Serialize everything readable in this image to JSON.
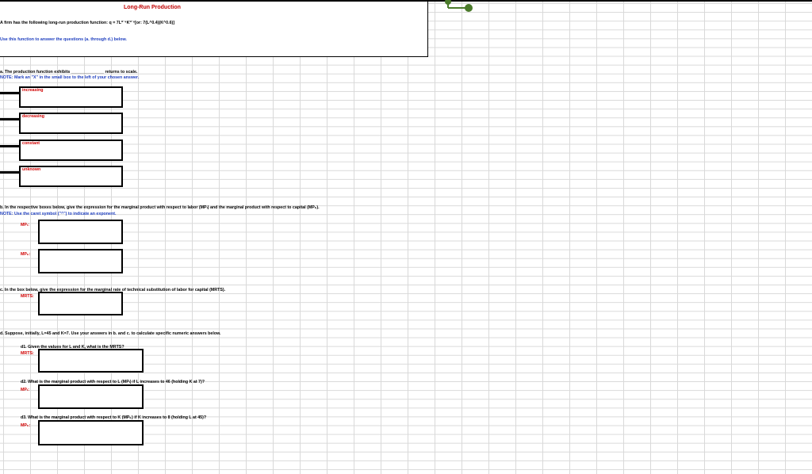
{
  "title": "Long-Run Production",
  "header": {
    "function_line": "A firm has the following long-run production function:  q = 7L⁰˙⁴K⁰˙⁶[or:  7(L^0.4)(K^0.6)]",
    "instruction": "Use this function to answer the questions (a. through d.) below."
  },
  "part_a": {
    "question": "a.  The production function exhibits ______________ returns to scale.",
    "note": "NOTE:  Mark an \"X\" in the small box to the left of your chosen answer.",
    "options": [
      "increasing",
      "decreasing",
      "constant",
      "unknown"
    ]
  },
  "part_b": {
    "question": "b.  In the respective boxes below, give the expression for the marginal product with respect to labor (MPₗ) and the marginal product with respect to capital (MPₖ).",
    "note": "NOTE:  Use the caret symbol (\"^\") to indicate an exponent.",
    "label_mpl": "MPₗ:",
    "label_mpk": "MPₖ:"
  },
  "part_c": {
    "question": "c.  In the box below, give the expression for the marginal rate of technical substitution of labor for capital (MRTS).",
    "label": "MRTS:"
  },
  "part_d": {
    "question": "d.  Suppose, initially,  L=45 and K=7.  Use your answers in b. and c. to calculate specific numeric answers below.",
    "d1": "d1.  Given the values for L and K, what is the MRTS?",
    "d1_label": "MRTS:",
    "d2": "d2.  What is the marginal product with respect to L (MPₗ) if L increases to 46 (holding K at 7)?",
    "d2_label": "MPₗ:",
    "d3": "d3.  What is the marginal product with respect to K (MPₖ) if K increases to 8 (holding L at 45)?",
    "d3_label": "MPₖ:"
  },
  "colors": {
    "title": "#c00000",
    "note": "#1f3fbf",
    "label": "#d00000",
    "connector": "#4a7a2a"
  }
}
